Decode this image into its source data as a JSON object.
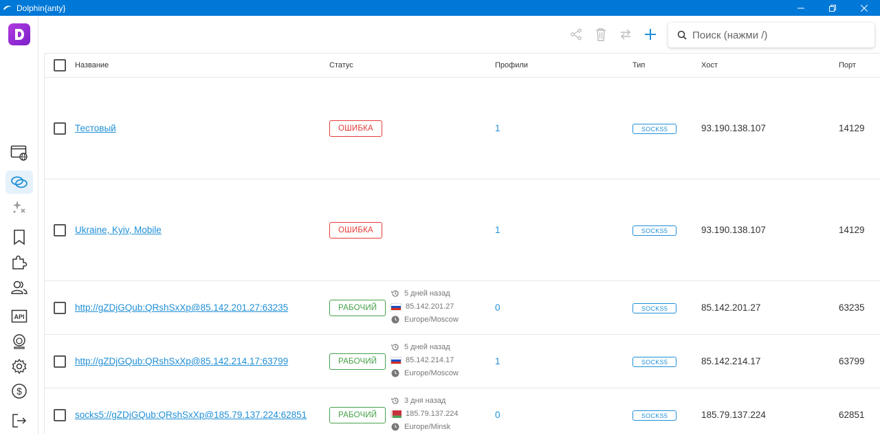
{
  "window": {
    "title": "Dolphin{anty}"
  },
  "toolbar": {
    "search_placeholder": "Поиск (нажми /)"
  },
  "table": {
    "headers": {
      "name": "Название",
      "status": "Статус",
      "profiles": "Профили",
      "type": "Тип",
      "host": "Хост",
      "port": "Порт"
    },
    "rows": [
      {
        "name": "Тестовый",
        "status": "ОШИБКА",
        "profiles": "1",
        "type": "SOCKS5",
        "host": "93.190.138.107",
        "port": "14129"
      },
      {
        "name": "Ukraine, Kyiv, Mobile",
        "status": "ОШИБКА",
        "profiles": "1",
        "type": "SOCKS5",
        "host": "93.190.138.107",
        "port": "14129"
      },
      {
        "name": "http://gZDjGQub:QRshSxXp@85.142.201.27:63235",
        "status": "РАБОЧИЙ",
        "checked": "5 дней назад",
        "ip": "85.142.201.27",
        "timezone": "Europe/Moscow",
        "profiles": "0",
        "type": "SOCKS5",
        "host": "85.142.201.27",
        "port": "63235"
      },
      {
        "name": "http://gZDjGQub:QRshSxXp@85.142.214.17:63799",
        "status": "РАБОЧИЙ",
        "checked": "5 дней назад",
        "ip": "85.142.214.17",
        "timezone": "Europe/Moscow",
        "profiles": "1",
        "type": "SOCKS5",
        "host": "85.142.214.17",
        "port": "63799"
      },
      {
        "name": "socks5://gZDjGQub:QRshSxXp@185.79.137.224:62851",
        "status": "РАБОЧИЙ",
        "checked": "3 дня назад",
        "ip": "185.79.137.224",
        "timezone": "Europe/Minsk",
        "profiles": "0",
        "type": "SOCKS5",
        "host": "185.79.137.224",
        "port": "62851"
      }
    ]
  },
  "colors": {
    "accent": "#1f8fd6",
    "error": "#e53935",
    "ok": "#43a047",
    "titlebar": "#0078d7"
  }
}
